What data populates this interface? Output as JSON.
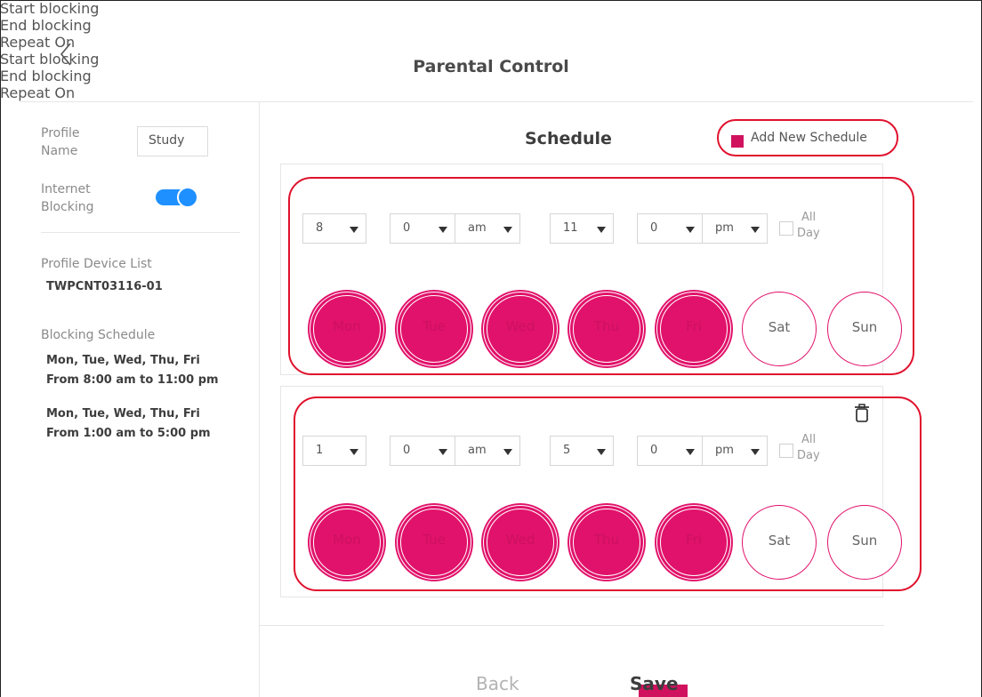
{
  "header": {
    "title": "Parental Control"
  },
  "profile": {
    "name_label": "Profile\nName",
    "name_value": "Study",
    "blocking_label": "Internet\nBlocking",
    "blocking_on": true,
    "device_list_label": "Profile Device List",
    "device": "TWPCNT03116-01",
    "schedule_label": "Blocking Schedule",
    "schedules": [
      {
        "days": "Mon, Tue, Wed, Thu, Fri",
        "range": "From 8:00 am to 11:00 pm"
      },
      {
        "days": "Mon, Tue, Wed, Thu, Fri",
        "range": "From 1:00 am to 5:00 pm"
      }
    ]
  },
  "schedule_panel": {
    "title": "Schedule",
    "add_label": "Add New Schedule",
    "start_label": "Start blocking",
    "end_label": "End blocking",
    "repeat_label": "Repeat On",
    "allday_label_1": "All",
    "allday_label_2": "Day",
    "day_names": [
      "Mon",
      "Tue",
      "Wed",
      "Thu",
      "Fri",
      "Sat",
      "Sun"
    ],
    "items": [
      {
        "start_hour": "8",
        "start_min": "0",
        "start_ampm": "am",
        "end_hour": "11",
        "end_min": "0",
        "end_ampm": "pm",
        "all_day": false,
        "active_days": [
          true,
          true,
          true,
          true,
          true,
          false,
          false
        ]
      },
      {
        "start_hour": "1",
        "start_min": "0",
        "start_ampm": "am",
        "end_hour": "5",
        "end_min": "0",
        "end_ampm": "pm",
        "all_day": false,
        "active_days": [
          true,
          true,
          true,
          true,
          true,
          false,
          false
        ]
      }
    ]
  },
  "footer": {
    "back_label": "Back",
    "save_label": "Save"
  },
  "colors": {
    "accent": "#e1126b",
    "highlight_ring": "#e0112d",
    "toggle": "#1e90ff"
  }
}
